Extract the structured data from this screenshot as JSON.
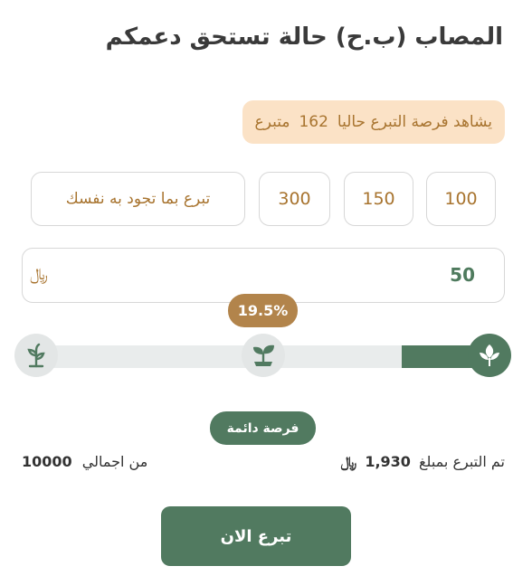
{
  "case": {
    "title": "المصاب (ب.ح) حالة تستحق دعمكم"
  },
  "viewers": {
    "prefix": "يشاهد فرصة التبرع حاليا",
    "count": "162",
    "suffix": "متبرع"
  },
  "amount_options": [
    "100",
    "150",
    "300"
  ],
  "custom_amount_label": "تبرع بما تجود به نفسك",
  "amount_input": {
    "value": "50",
    "currency": "﷼"
  },
  "progress": {
    "percent_label": "19.5%",
    "percent": 19.5
  },
  "status": {
    "label": "فرصة دائمة"
  },
  "raised": {
    "prefix": "تم التبرع بمبلغ",
    "amount": "1,930",
    "currency": "﷼"
  },
  "total": {
    "prefix": "من اجمالي",
    "amount": "10000"
  },
  "donate_button": {
    "label": "تبرع الان"
  },
  "colors": {
    "accent_green": "#517a60",
    "accent_gold": "#b2844b",
    "badge_bg": "#fbe2c6",
    "track_bg": "#e9ecec"
  },
  "icons": {
    "stage_start": "sprout-icon",
    "stage_mid": "seedling-icon",
    "stage_end": "leaves-icon"
  }
}
